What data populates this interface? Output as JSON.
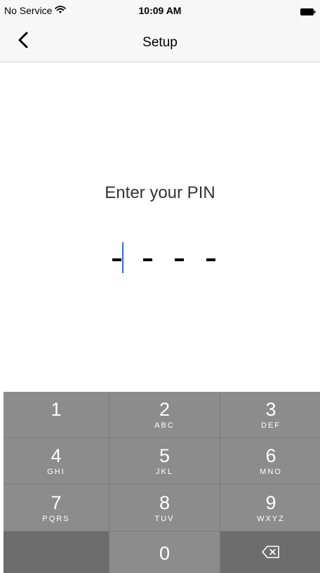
{
  "status_bar": {
    "carrier": "No Service",
    "time": "10:09 AM"
  },
  "nav": {
    "title": "Setup"
  },
  "main": {
    "prompt": "Enter your PIN",
    "pin_length": 4,
    "entered_digits": 0
  },
  "keypad": {
    "keys": [
      {
        "digit": "1",
        "letters": ""
      },
      {
        "digit": "2",
        "letters": "ABC"
      },
      {
        "digit": "3",
        "letters": "DEF"
      },
      {
        "digit": "4",
        "letters": "GHI"
      },
      {
        "digit": "5",
        "letters": "JKL"
      },
      {
        "digit": "6",
        "letters": "MNO"
      },
      {
        "digit": "7",
        "letters": "PQRS"
      },
      {
        "digit": "8",
        "letters": "TUV"
      },
      {
        "digit": "9",
        "letters": "WXYZ"
      },
      {
        "digit": "0",
        "letters": ""
      }
    ]
  },
  "icons": {
    "wifi": "wifi-icon",
    "battery": "battery-icon",
    "back": "chevron-left-icon",
    "delete": "backspace-icon"
  },
  "colors": {
    "cursor": "#2f6bd8",
    "key_background": "#8c8c8c",
    "key_dark_background": "#6d6d6d",
    "bar_background": "#f7f7f7"
  }
}
